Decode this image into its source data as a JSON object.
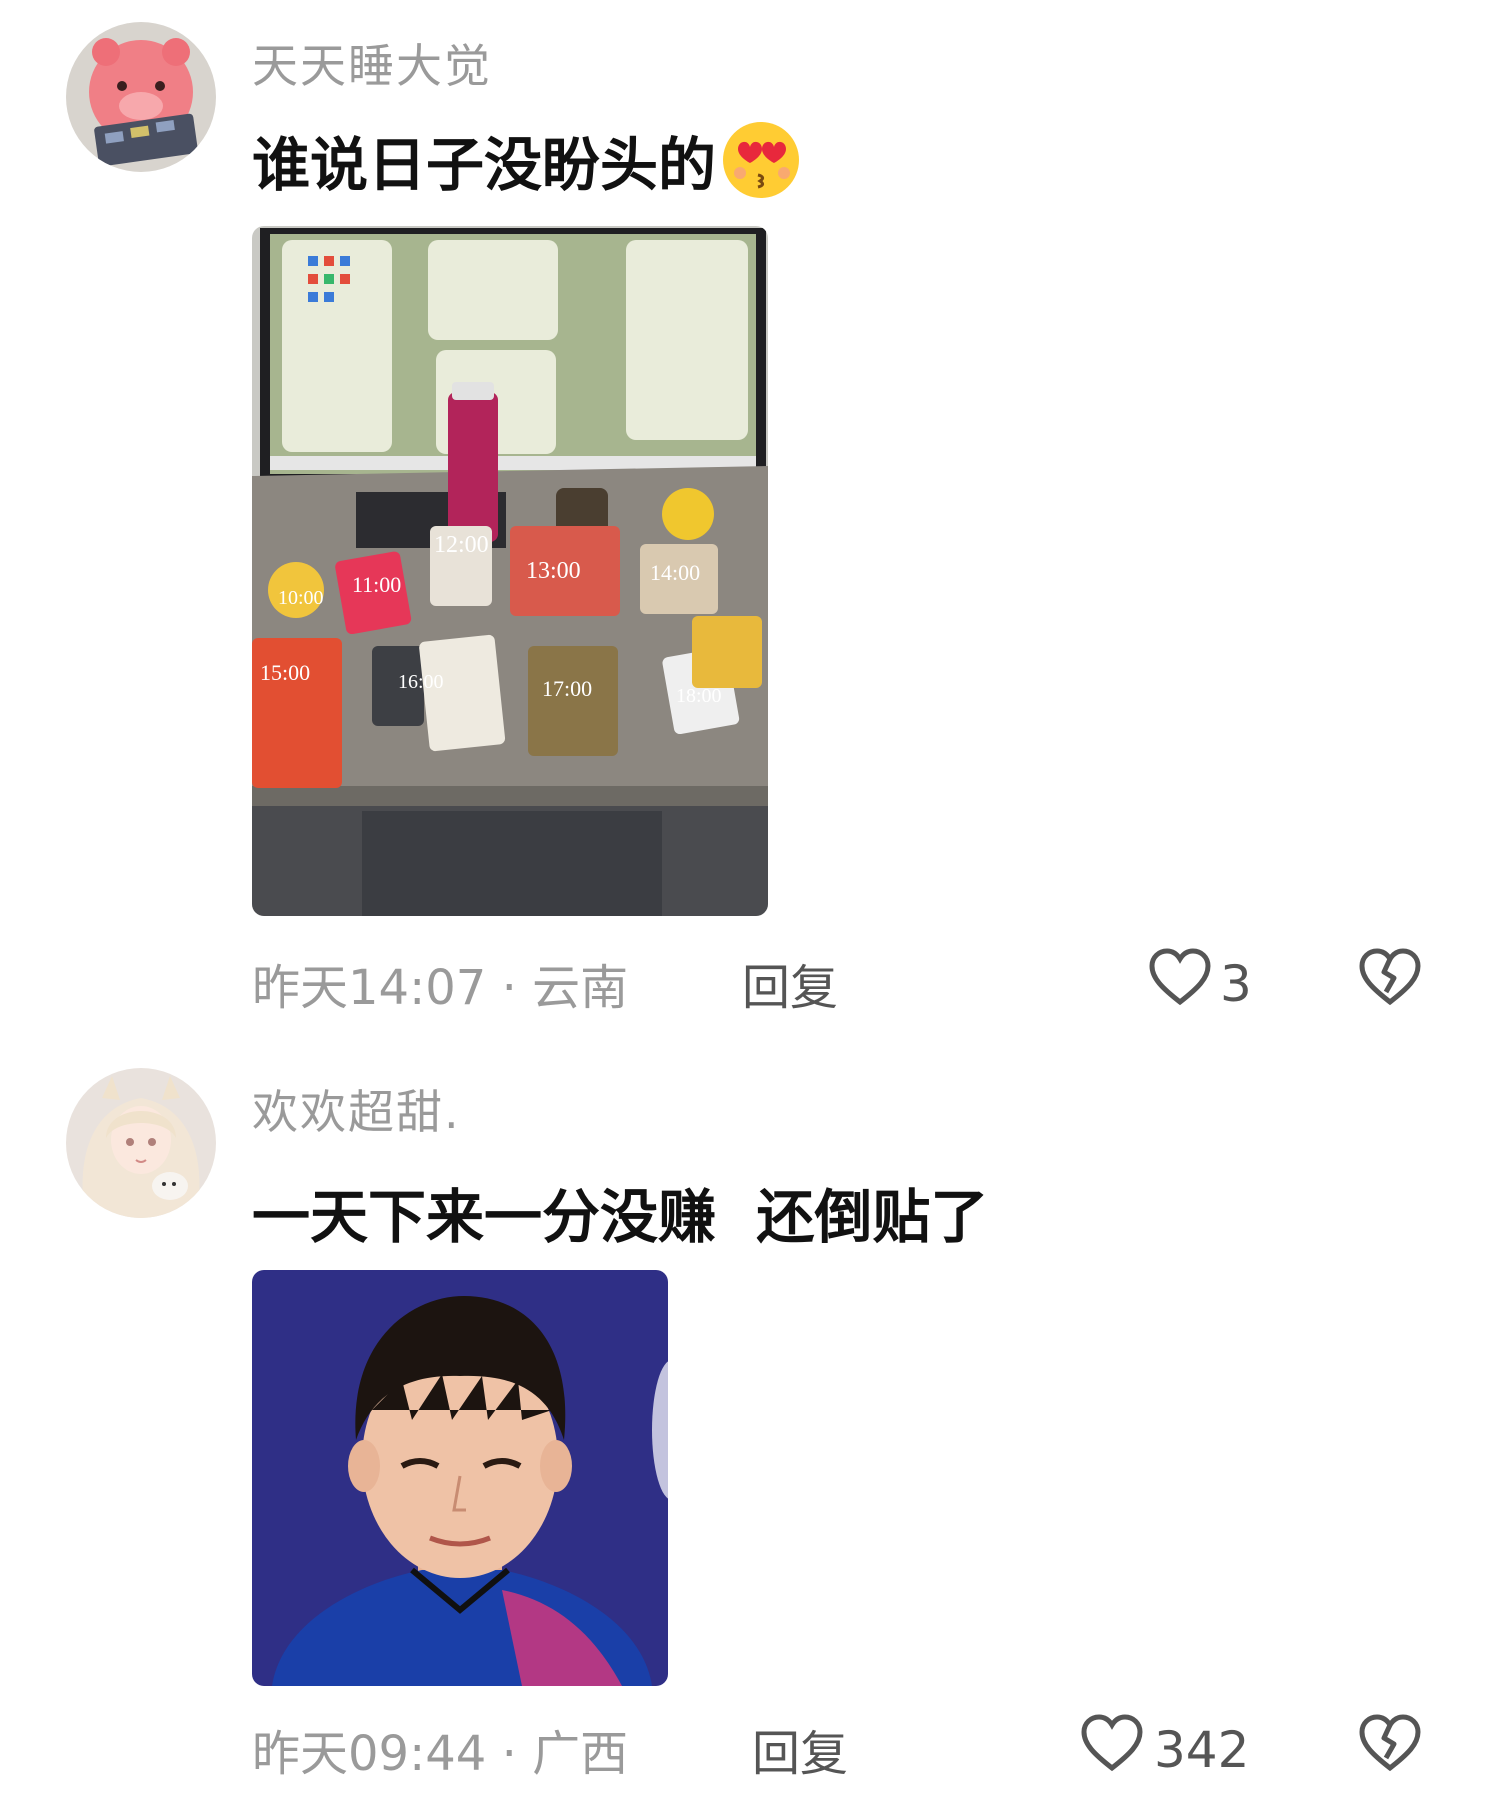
{
  "comments": [
    {
      "username": "天天睡大觉",
      "text": "谁说日子没盼头的",
      "emoji": "heart-eyes-kiss-emoji",
      "photo_labels": [
        "12:00",
        "13:00",
        "14:00",
        "10:00",
        "11:00",
        "15:00",
        "16:00",
        "17:00",
        "18:00"
      ],
      "meta": "昨天14:07 · 云南",
      "reply_label": "回复",
      "like_count": "3"
    },
    {
      "username": "欢欢超甜.",
      "text": "一天下来一分没赚  还倒贴了",
      "meta": "昨天09:44 · 广西",
      "reply_label": "回复",
      "like_count": "342"
    }
  ]
}
